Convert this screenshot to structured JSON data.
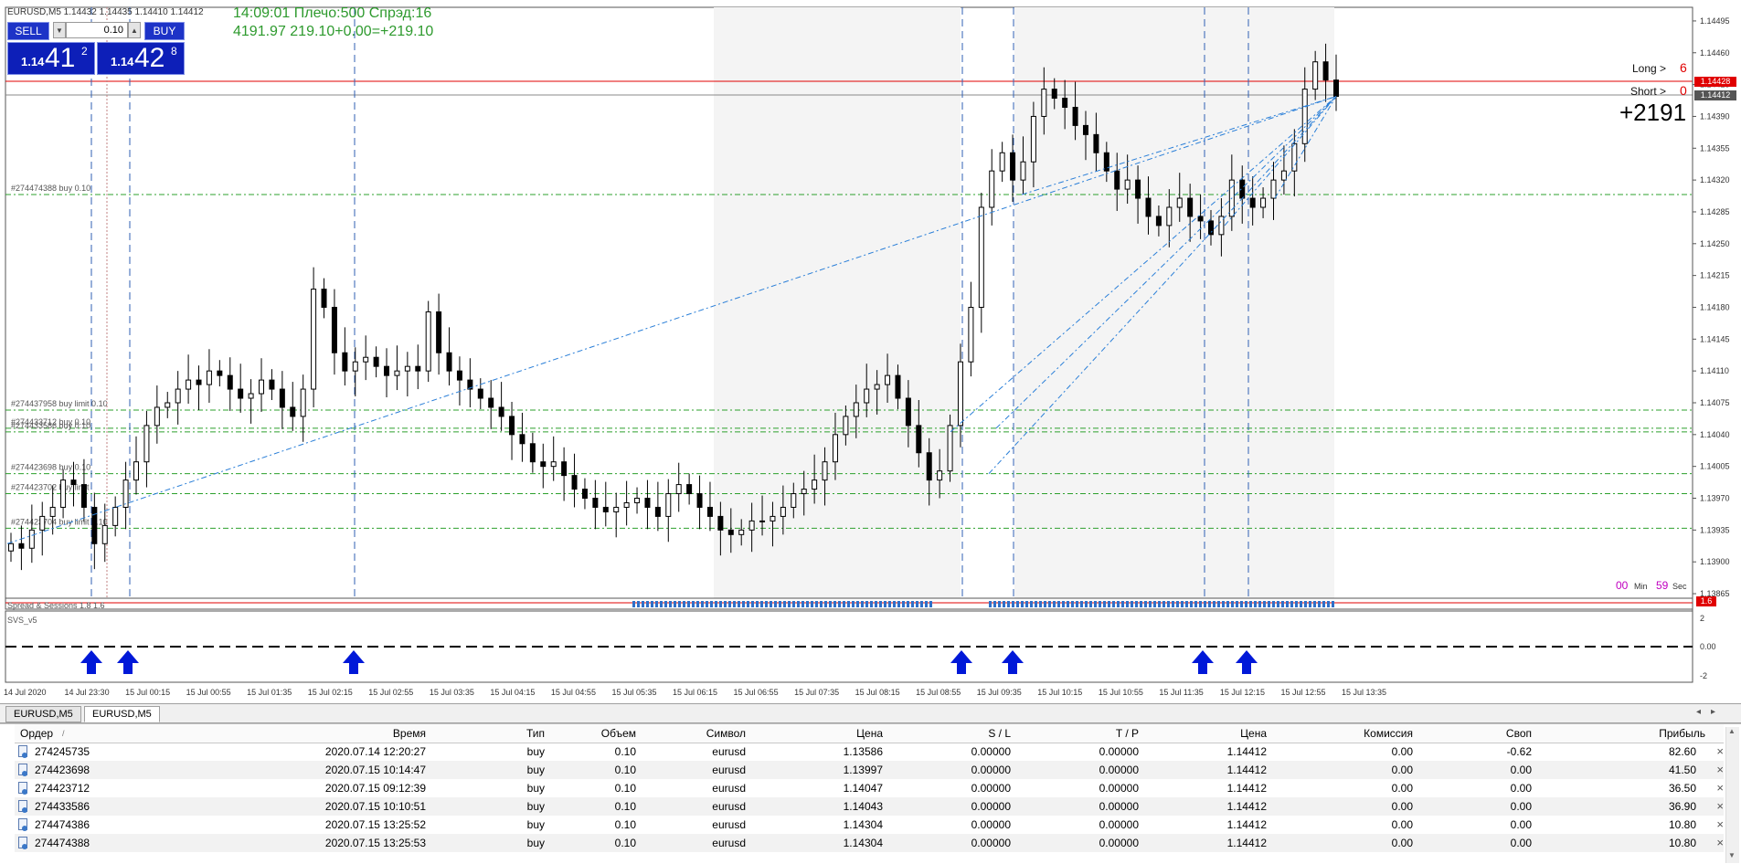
{
  "chart": {
    "symbol_info": "EURUSD,M5  1.14432 1.14435 1.14410 1.14412",
    "status_line1": "14:09:01 Плечо:500 Спрэд:16",
    "status_line2": "4191.97  219.10+0.00=+219.10",
    "long_label": "Long >",
    "long_value": "6",
    "short_label": "Short >",
    "short_value": "0",
    "profit_big": "+2191",
    "timer_min": "00",
    "timer_min_label": "Min",
    "timer_sec": "59",
    "timer_sec_label": "Sec",
    "indicator1_label": "Spread & Sessions 1.8 1.6",
    "indicator1_value": "1.6",
    "indicator2_label": "SVS_v5",
    "price_tag_red": "1.14428",
    "price_tag_gray": "1.14412",
    "order_labels": [
      {
        "text": "#274474388 buy 0.10",
        "price": 1.14304
      },
      {
        "text": "#274437958 buy limit 0.10",
        "price": 1.14067
      },
      {
        "text": "#274433712 buy 0.10",
        "price": 1.14047
      },
      {
        "text": "#274433586 buy 0.10",
        "price": 1.14043
      },
      {
        "text": "#274423698 buy 0.10",
        "price": 1.13997
      },
      {
        "text": "#274423702 buy limit",
        "price": 1.13975
      },
      {
        "text": "#274423704 buy limit 0.10",
        "price": 1.13937
      }
    ],
    "price_ticks": [
      "1.14495",
      "1.14460",
      "1.14425",
      "1.14390",
      "1.14355",
      "1.14320",
      "1.14285",
      "1.14250",
      "1.14215",
      "1.14180",
      "1.14145",
      "1.14110",
      "1.14075",
      "1.14040",
      "1.14005",
      "1.13970",
      "1.13935",
      "1.13900",
      "1.13865"
    ],
    "svs_ticks": [
      "2",
      "0.00",
      "-2"
    ],
    "time_ticks": [
      "14 Jul 2020",
      "14 Jul 23:30",
      "15 Jul 00:15",
      "15 Jul 00:55",
      "15 Jul 01:35",
      "15 Jul 02:15",
      "15 Jul 02:55",
      "15 Jul 03:35",
      "15 Jul 04:15",
      "15 Jul 04:55",
      "15 Jul 05:35",
      "15 Jul 06:15",
      "15 Jul 06:55",
      "15 Jul 07:35",
      "15 Jul 08:15",
      "15 Jul 08:55",
      "15 Jul 09:35",
      "15 Jul 10:15",
      "15 Jul 10:55",
      "15 Jul 11:35",
      "15 Jul 12:15",
      "15 Jul 12:55",
      "15 Jul 13:35"
    ]
  },
  "trade_panel": {
    "sell_label": "SELL",
    "buy_label": "BUY",
    "lot": "0.10",
    "sell_small": "1.14",
    "sell_big": "41",
    "sell_sup": "2",
    "buy_small": "1.14",
    "buy_big": "42",
    "buy_sup": "8"
  },
  "tabs": [
    {
      "label": "EURUSD,M5",
      "active": false
    },
    {
      "label": "EURUSD,M5",
      "active": true
    }
  ],
  "orders": {
    "headers": {
      "order": "Ордер",
      "sort": "/",
      "time": "Время",
      "type": "Тип",
      "volume": "Объем",
      "symbol": "Символ",
      "price": "Цена",
      "sl": "S / L",
      "tp": "T / P",
      "price2": "Цена",
      "commission": "Комиссия",
      "swap": "Своп",
      "profit": "Прибыль"
    },
    "rows": [
      {
        "order": "274245735",
        "time": "2020.07.14 12:20:27",
        "type": "buy",
        "volume": "0.10",
        "symbol": "eurusd",
        "price": "1.13586",
        "sl": "0.00000",
        "tp": "0.00000",
        "price2": "1.14412",
        "commission": "0.00",
        "swap": "-0.62",
        "profit": "82.60"
      },
      {
        "order": "274423698",
        "time": "2020.07.15 10:14:47",
        "type": "buy",
        "volume": "0.10",
        "symbol": "eurusd",
        "price": "1.13997",
        "sl": "0.00000",
        "tp": "0.00000",
        "price2": "1.14412",
        "commission": "0.00",
        "swap": "0.00",
        "profit": "41.50"
      },
      {
        "order": "274423712",
        "time": "2020.07.15 09:12:39",
        "type": "buy",
        "volume": "0.10",
        "symbol": "eurusd",
        "price": "1.14047",
        "sl": "0.00000",
        "tp": "0.00000",
        "price2": "1.14412",
        "commission": "0.00",
        "swap": "0.00",
        "profit": "36.50"
      },
      {
        "order": "274433586",
        "time": "2020.07.15 10:10:51",
        "type": "buy",
        "volume": "0.10",
        "symbol": "eurusd",
        "price": "1.14043",
        "sl": "0.00000",
        "tp": "0.00000",
        "price2": "1.14412",
        "commission": "0.00",
        "swap": "0.00",
        "profit": "36.90"
      },
      {
        "order": "274474386",
        "time": "2020.07.15 13:25:52",
        "type": "buy",
        "volume": "0.10",
        "symbol": "eurusd",
        "price": "1.14304",
        "sl": "0.00000",
        "tp": "0.00000",
        "price2": "1.14412",
        "commission": "0.00",
        "swap": "0.00",
        "profit": "10.80"
      },
      {
        "order": "274474388",
        "time": "2020.07.15 13:25:53",
        "type": "buy",
        "volume": "0.10",
        "symbol": "eurusd",
        "price": "1.14304",
        "sl": "0.00000",
        "tp": "0.00000",
        "price2": "1.14412",
        "commission": "0.00",
        "swap": "0.00",
        "profit": "10.80"
      }
    ],
    "close_symbol": "×"
  },
  "colors": {
    "sell_bg": "#1d33c7",
    "status_text": "#2e9a2e",
    "order_line": "#2ca02c",
    "vline": "#2f5fb3",
    "arrow": "#0018d8",
    "red_line": "#e00000"
  }
}
